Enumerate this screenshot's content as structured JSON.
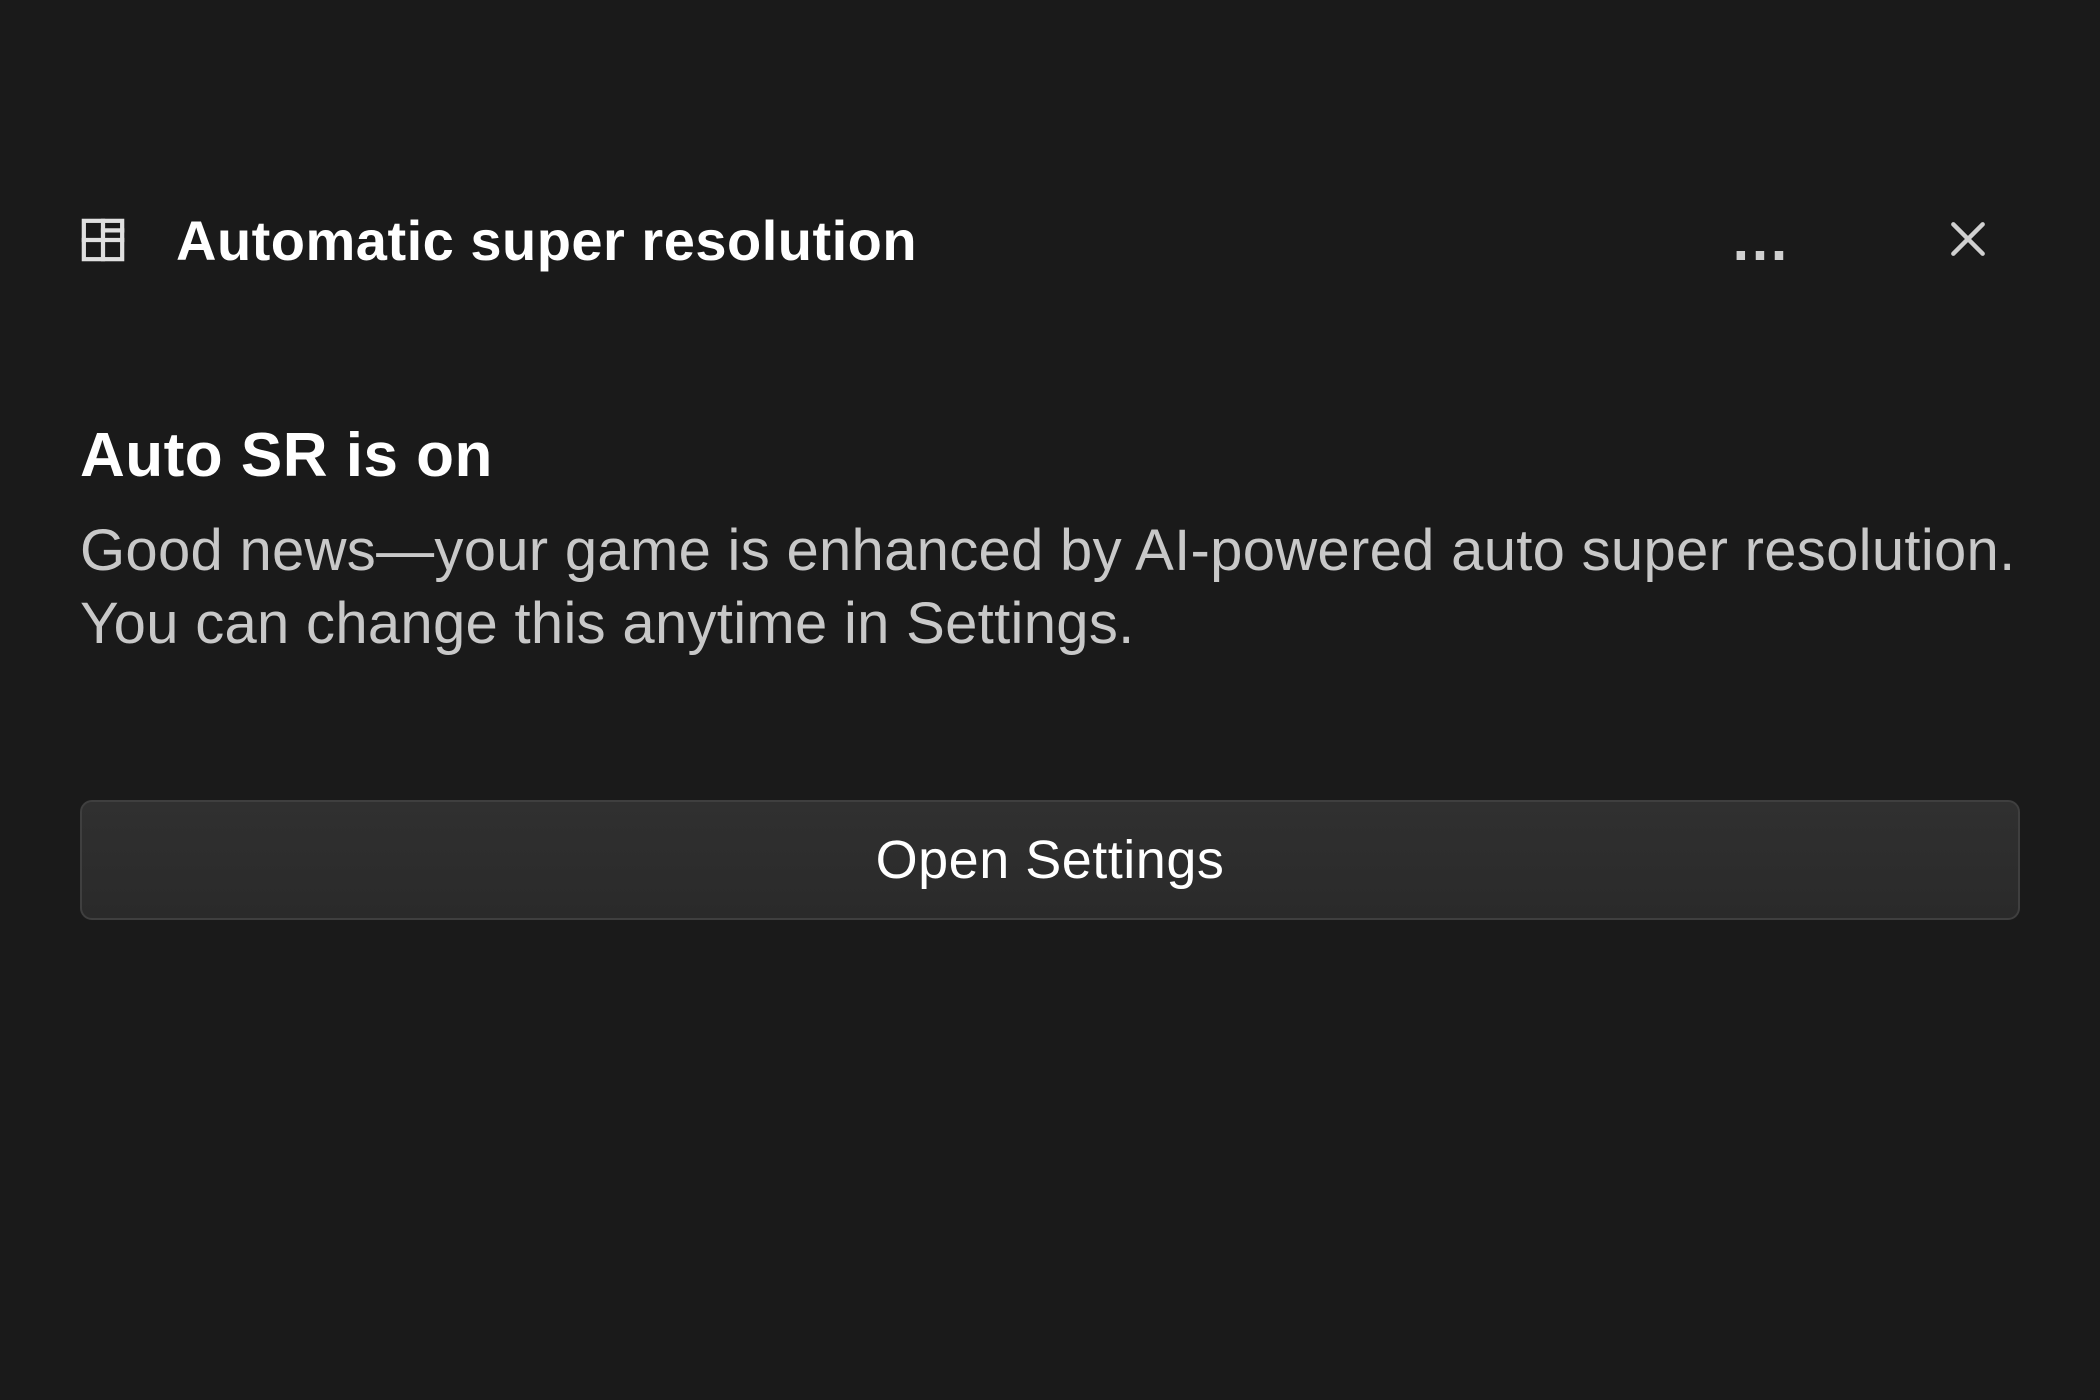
{
  "header": {
    "icon_name": "grid-icon",
    "title": "Automatic super resolution",
    "more_label": "…",
    "close_label": "Close"
  },
  "content": {
    "heading": "Auto SR is on",
    "body": "Good news—your game is enhanced by AI-powered auto super resolution. You can change this anytime in Settings."
  },
  "actions": {
    "primary_label": "Open Settings"
  }
}
